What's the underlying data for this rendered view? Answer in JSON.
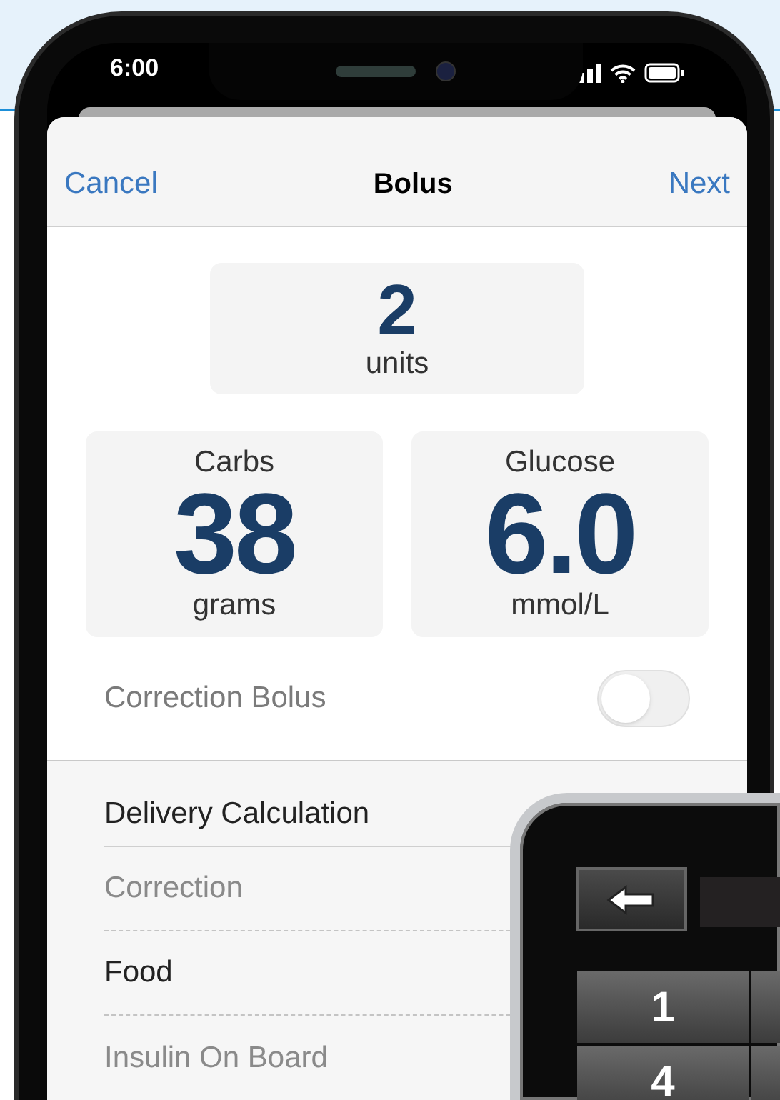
{
  "status_bar": {
    "time": "6:00"
  },
  "nav": {
    "cancel": "Cancel",
    "title": "Bolus",
    "next": "Next"
  },
  "units": {
    "value": "2",
    "label": "units"
  },
  "tiles": [
    {
      "label": "Carbs",
      "value": "38",
      "unit": "grams"
    },
    {
      "label": "Glucose",
      "value": "6.0",
      "unit": "mmol/L"
    }
  ],
  "correction_bolus": {
    "label": "Correction Bolus",
    "on": false
  },
  "delivery": {
    "title": "Delivery Calculation",
    "rows": [
      {
        "label": "Correction",
        "muted": true
      },
      {
        "label": "Food",
        "muted": false
      },
      {
        "label": "Insulin On Board",
        "muted": true
      }
    ]
  },
  "pump": {
    "keys": [
      "1",
      "4"
    ]
  }
}
